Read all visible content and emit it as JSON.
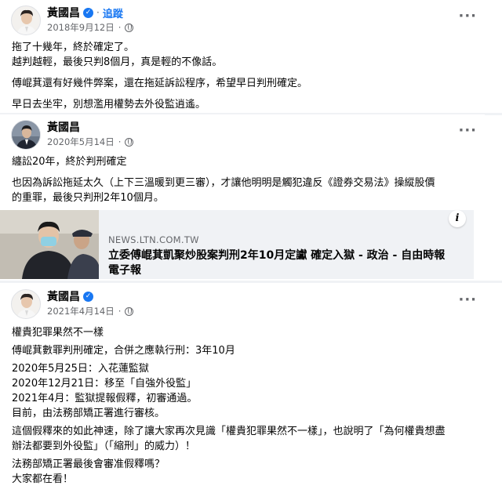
{
  "posts": [
    {
      "author": "黃國昌",
      "follow_label": "追蹤",
      "separator": "·",
      "date": "2018年9月12日",
      "more": "···",
      "lines": [
        "拖了十幾年，終於確定了。",
        "越判越輕，最後只判8個月，真是輕的不像話。",
        "",
        "傅崐萁還有好幾件弊案，還在拖延訴訟程序，希望早日判刑確定。",
        "",
        "早日去坐牢，別想濫用權勢去外役監逍遙。"
      ]
    },
    {
      "author": "黃國昌",
      "date": "2020年5月14日",
      "separator": "·",
      "more": "···",
      "lines": [
        "纏訟20年，終於判刑確定",
        "",
        "也因為訴訟拖延太久（上下三溫暖到更三審），才讓他明明是觸犯違反《證券交易法》操縱股價",
        "的重罪，最後只判刑2年10個月。"
      ],
      "link": {
        "domain": "NEWS.LTN.COM.TW",
        "title_line1": "立委傅崐萁凱聚炒股案判刑2年10月定讞 確定入獄 - 政治 - 自由時報",
        "title_line2": "電子報",
        "info": "i"
      }
    },
    {
      "author": "黃國昌",
      "date": "2021年4月14日",
      "separator": "·",
      "more": "···",
      "lines": [
        "權貴犯罪果然不一樣",
        "",
        "傅崐萁數罪判刑確定，合併之應執行刑：3年10月",
        "",
        "2020年5月25日：入花蓮監獄",
        "2020年12月21日：移至「自強外役監」",
        "2021年4月：監獄提報假釋，初審通過。",
        "目前，由法務部矯正署進行審核。",
        "",
        "這個假釋來的如此神速，除了讓大家再次見識「權貴犯罪果然不一樣」，也說明了「為何權貴想盡",
        "辦法都要到外役監」（「縮刑」的威力）！",
        "",
        "法務部矯正署最後會審准假釋嗎？",
        "大家都在看！"
      ]
    }
  ]
}
